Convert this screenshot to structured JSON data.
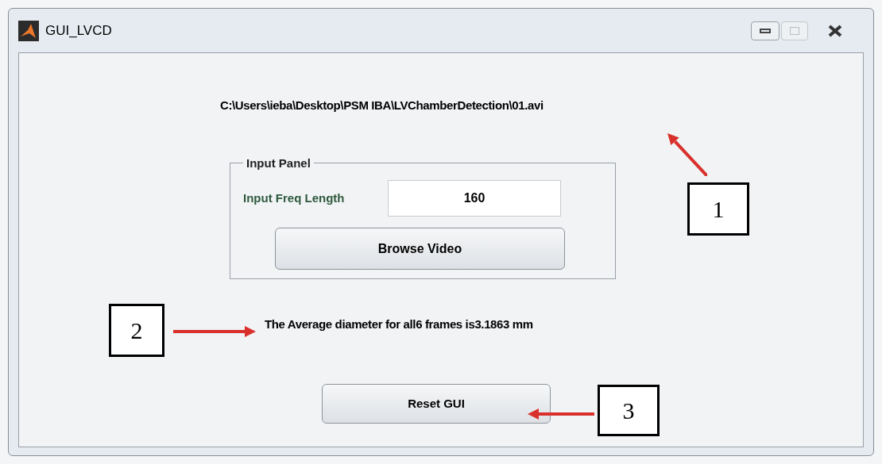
{
  "window": {
    "title": "GUI_LVCD"
  },
  "file_path": "C:\\Users\\ieba\\Desktop\\PSM IBA\\LVChamberDetection\\01.avi",
  "input_panel": {
    "title": "Input Panel",
    "field_label": "Input Freq Length",
    "field_value": "160",
    "button": "Browse Video"
  },
  "result_text": "The Average diameter for all6 frames is3.1863 mm",
  "reset_button": "Reset GUI",
  "callouts": [
    "1",
    "2",
    "3"
  ]
}
